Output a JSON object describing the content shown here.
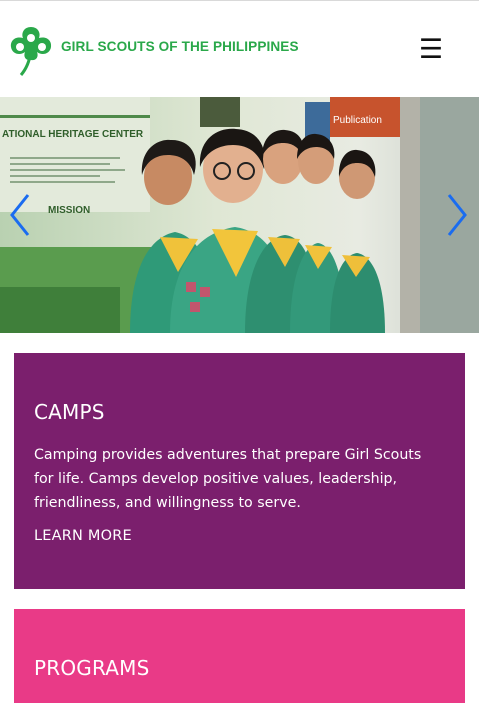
{
  "header": {
    "brand_name": "GIRL SCOUTS OF THE PHILIPPINES",
    "logo_icon": "trefoil-logo-icon",
    "menu_icon": "hamburger-menu-icon",
    "menu_glyph": "☰",
    "brand_color": "#2aa84a"
  },
  "hero": {
    "sign_heritage": "ATIONAL HERITAGE CENTER",
    "sign_mission": "MISSION",
    "sign_publication": "Publication",
    "prev_icon": "chevron-left-icon",
    "next_icon": "chevron-right-icon",
    "arrow_color": "#1a6cf0"
  },
  "cards": {
    "camps": {
      "title": "CAMPS",
      "text": "Camping provides adventures that prepare Girl Scouts for life. Camps develop positive values, leadership, friendliness, and willingness to serve.",
      "link": "LEARN MORE",
      "color": "#7b1f6d"
    },
    "programs": {
      "title": "PROGRAMS",
      "color": "#e93a87"
    }
  }
}
